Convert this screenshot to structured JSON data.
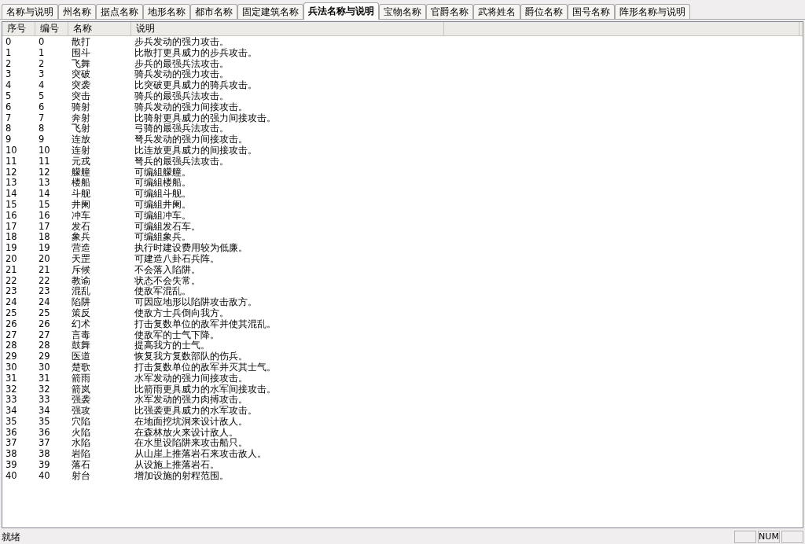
{
  "tabs": [
    {
      "label": "名称与说明",
      "selected": false
    },
    {
      "label": "州名称",
      "selected": false
    },
    {
      "label": "据点名称",
      "selected": false
    },
    {
      "label": "地形名称",
      "selected": false
    },
    {
      "label": "都市名称",
      "selected": false
    },
    {
      "label": "固定建筑名称",
      "selected": false
    },
    {
      "label": "兵法名称与说明",
      "selected": true
    },
    {
      "label": "宝物名称",
      "selected": false
    },
    {
      "label": "官爵名称",
      "selected": false
    },
    {
      "label": "武将姓名",
      "selected": false
    },
    {
      "label": "爵位名称",
      "selected": false
    },
    {
      "label": "国号名称",
      "selected": false
    },
    {
      "label": "阵形名称与说明",
      "selected": false
    }
  ],
  "table": {
    "columns": [
      "序号",
      "编号",
      "名称",
      "说明"
    ],
    "rows": [
      [
        "0",
        "0",
        "散打",
        "步兵发动的强力攻击。"
      ],
      [
        "1",
        "1",
        "围斗",
        "比散打更具威力的步兵攻击。"
      ],
      [
        "2",
        "2",
        "飞舞",
        "步兵的最强兵法攻击。"
      ],
      [
        "3",
        "3",
        "突破",
        "骑兵发动的强力攻击。"
      ],
      [
        "4",
        "4",
        "突袭",
        "比突破更具威力的骑兵攻击。"
      ],
      [
        "5",
        "5",
        "突击",
        "骑兵的最强兵法攻击。"
      ],
      [
        "6",
        "6",
        "骑射",
        "骑兵发动的强力间接攻击。"
      ],
      [
        "7",
        "7",
        "奔射",
        "比骑射更具威力的强力间接攻击。"
      ],
      [
        "8",
        "8",
        "飞射",
        "弓骑的最强兵法攻击。"
      ],
      [
        "9",
        "9",
        "连放",
        "弩兵发动的强力间接攻击。"
      ],
      [
        "10",
        "10",
        "连射",
        "比连放更具威力的间接攻击。"
      ],
      [
        "11",
        "11",
        "元戎",
        "弩兵的最强兵法攻击。"
      ],
      [
        "12",
        "12",
        "艨艟",
        "可编組艨艟。"
      ],
      [
        "13",
        "13",
        "楼船",
        "可编組楼船。"
      ],
      [
        "14",
        "14",
        "斗舰",
        "可编組斗舰。"
      ],
      [
        "15",
        "15",
        "井阑",
        "可编組井阑。"
      ],
      [
        "16",
        "16",
        "冲车",
        "可编組冲车。"
      ],
      [
        "17",
        "17",
        "发石",
        "可编組发石车。"
      ],
      [
        "18",
        "18",
        "象兵",
        "可编組象兵。"
      ],
      [
        "19",
        "19",
        "营造",
        "执行时建设费用较为低廉。"
      ],
      [
        "20",
        "20",
        "天罡",
        "可建造八卦石兵阵。"
      ],
      [
        "21",
        "21",
        "斥候",
        "不会落入陷阱。"
      ],
      [
        "22",
        "22",
        "教谕",
        "状态不会失常。"
      ],
      [
        "23",
        "23",
        "混乱",
        "使敌军混乱。"
      ],
      [
        "24",
        "24",
        "陷阱",
        "可因应地形以陷阱攻击敌方。"
      ],
      [
        "25",
        "25",
        "策反",
        "使敌方士兵倒向我方。"
      ],
      [
        "26",
        "26",
        "幻术",
        "打击复数单位的敌军并使其混乱。"
      ],
      [
        "27",
        "27",
        "言毒",
        "使敌军的士气下降。"
      ],
      [
        "28",
        "28",
        "鼓舞",
        "提高我方的士气。"
      ],
      [
        "29",
        "29",
        "医道",
        "恢复我方复数部队的伤兵。"
      ],
      [
        "30",
        "30",
        "楚歌",
        "打击复数单位的敌军并灭其士气。"
      ],
      [
        "31",
        "31",
        "箭雨",
        "水军发动的强力间接攻击。"
      ],
      [
        "32",
        "32",
        "箭岚",
        "比箭雨更具威力的水军间接攻击。"
      ],
      [
        "33",
        "33",
        "强袭",
        "水军发动的强力肉搏攻击。"
      ],
      [
        "34",
        "34",
        "强攻",
        "比强袭更具威力的水军攻击。"
      ],
      [
        "35",
        "35",
        "穴陷",
        "在地面挖坑洞来设计敌人。"
      ],
      [
        "36",
        "36",
        "火陷",
        "在森林放火来设计敌人。"
      ],
      [
        "37",
        "37",
        "水陷",
        "在水里设陷阱来攻击船只。"
      ],
      [
        "38",
        "38",
        "岩陷",
        "从山崖上推落岩石来攻击敌人。"
      ],
      [
        "39",
        "39",
        "落石",
        "从设施上推落岩石。"
      ],
      [
        "40",
        "40",
        "射台",
        "增加设施的射程范围。"
      ]
    ]
  },
  "status_bar": {
    "text": "就绪",
    "indicators": [
      "NUM"
    ]
  }
}
